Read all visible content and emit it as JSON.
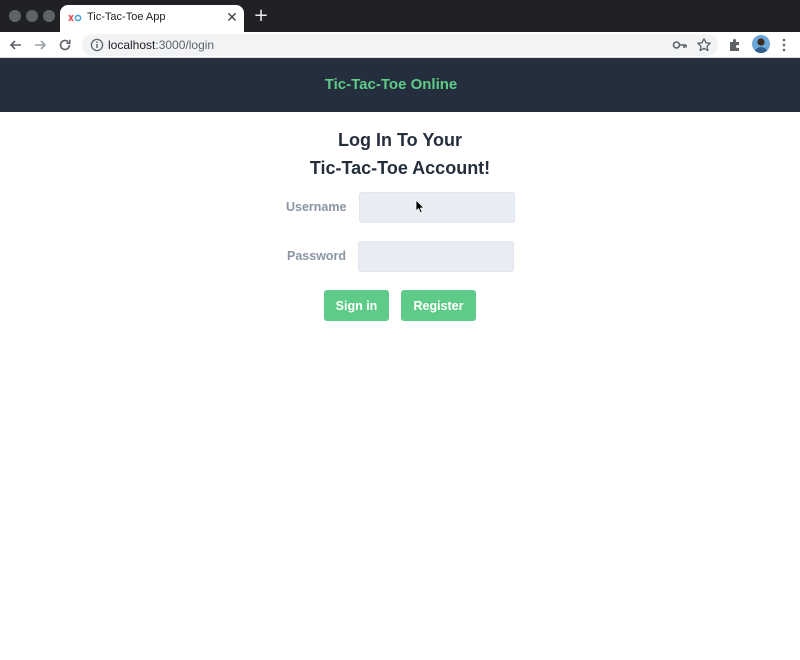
{
  "browser": {
    "tab": {
      "title": "Tic-Tac-Toe App",
      "close_glyph": "✕",
      "favicon": "tic-tac-toe-favicon"
    },
    "new_tab_glyph": "+",
    "address_bar": {
      "host": "localhost",
      "path": ":3000/login"
    },
    "icons": [
      "back-arrow-icon",
      "forward-arrow-icon",
      "reload-icon",
      "info-icon",
      "key-icon",
      "star-icon",
      "puzzle-icon",
      "avatar",
      "kebab-menu-icon"
    ]
  },
  "app": {
    "header_title": "Tic-Tac-Toe Online",
    "heading_line1": "Log In To Your",
    "heading_line2": "Tic-Tac-Toe Account!",
    "form": {
      "username_label": "Username",
      "username_value": "",
      "password_label": "Password",
      "password_value": "",
      "sign_in_label": "Sign in",
      "register_label": "Register"
    }
  },
  "colors": {
    "header_bg": "#252e3c",
    "accent_green": "#5fcb88",
    "input_bg": "#e8edf3",
    "label_gray": "#8c95a2",
    "heading_dark": "#252e3c"
  }
}
